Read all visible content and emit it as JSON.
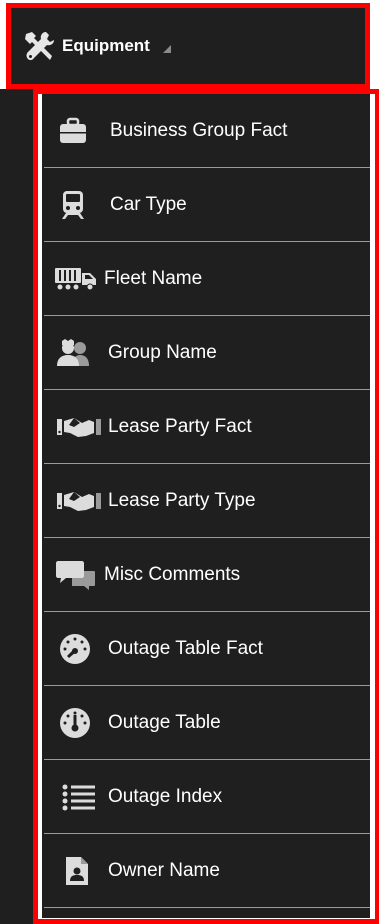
{
  "header": {
    "title": "Equipment",
    "icon": "tools-icon",
    "caret": "caret-down-icon"
  },
  "items": [
    {
      "label": "Business Group Fact",
      "icon": "briefcase-icon"
    },
    {
      "label": "Car Type",
      "icon": "train-icon"
    },
    {
      "label": "Fleet Name",
      "icon": "truck-icon"
    },
    {
      "label": "Group Name",
      "icon": "users-icon"
    },
    {
      "label": "Lease Party Fact",
      "icon": "handshake-icon"
    },
    {
      "label": "Lease Party Type",
      "icon": "handshake-icon"
    },
    {
      "label": "Misc Comments",
      "icon": "comments-icon"
    },
    {
      "label": "Outage Table Fact",
      "icon": "gauge-icon"
    },
    {
      "label": "Outage Table",
      "icon": "gauge-icon"
    },
    {
      "label": "Outage Index",
      "icon": "list-icon"
    },
    {
      "label": "Owner Name",
      "icon": "user-file-icon"
    }
  ],
  "colors": {
    "background": "#1f1f1f",
    "highlight": "#ff0000",
    "divider": "#9a9a9a",
    "text": "#ffffff",
    "icon": "#dcdcdc"
  }
}
